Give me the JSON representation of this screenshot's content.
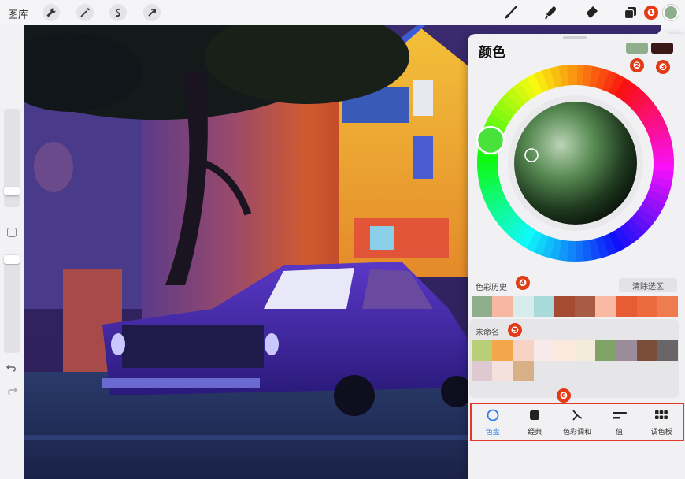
{
  "topbar": {
    "gallery_label": "图库",
    "left_tools": [
      "wrench-icon",
      "magic-wand-icon",
      "selection-icon",
      "transform-arrow-icon"
    ],
    "right_tools": [
      "brush-icon",
      "smudge-icon",
      "eraser-icon",
      "layers-icon"
    ],
    "current_color": "#8fae8c"
  },
  "badges": [
    "❶",
    "❷",
    "❸",
    "❹",
    "❺",
    "❻"
  ],
  "panel": {
    "title": "颜色",
    "primary_swatch": "#8fae8c",
    "secondary_swatch": "#3a1816",
    "history": {
      "label": "色彩历史",
      "clear_label": "清除选区",
      "colors": [
        "#8fae8c",
        "#f7b7a3",
        "#d8ecec",
        "#a8dada",
        "#a54a33",
        "#a85c44",
        "#fab9a3",
        "#e65c34",
        "#ed6a3e",
        "#ef7c4e"
      ]
    },
    "palette": {
      "label": "未命名",
      "colors": [
        "#b9cf77",
        "#f1a74a",
        "#f8d2c5",
        "#f7eae8",
        "#fbe9dd",
        "#f4ecdb",
        "#7fa465",
        "#9a8c9b",
        "#7a4e38",
        "#6a6566",
        "#dfc9d0",
        "#f4e1de",
        "#d8b088"
      ]
    },
    "nav": [
      {
        "label": "色盘",
        "icon": "disc-icon",
        "active": true
      },
      {
        "label": "经典",
        "icon": "classic-square-icon",
        "active": false
      },
      {
        "label": "色彩调和",
        "icon": "harmony-icon",
        "active": false
      },
      {
        "label": "值",
        "icon": "value-sliders-icon",
        "active": false
      },
      {
        "label": "调色板",
        "icon": "palette-grid-icon",
        "active": false
      }
    ]
  }
}
